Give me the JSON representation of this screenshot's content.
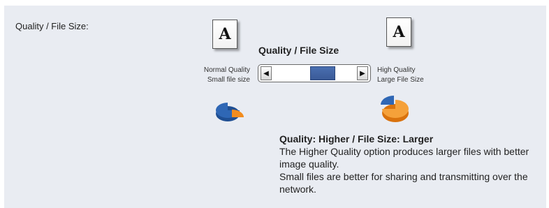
{
  "field_label": "Quality / File Size:",
  "slider": {
    "title": "Quality / File Size",
    "left_label_line1": "Normal Quality",
    "left_label_line2": "Small file size",
    "right_label_line1": "High Quality",
    "right_label_line2": "Large File Size",
    "value_fraction": 0.65,
    "left_arrow_icon": "arrow-left-icon",
    "right_arrow_icon": "arrow-right-icon"
  },
  "icons": {
    "left_doc": "A",
    "right_doc": "A",
    "left_pie": "pie-small-blue-icon",
    "right_pie": "pie-large-orange-icon"
  },
  "description": {
    "title": "Quality: Higher / File Size: Larger",
    "line1": "The Higher Quality option produces larger files with better image quality.",
    "line2": "Small files are better for sharing and transmitting over the network."
  },
  "colors": {
    "panel_bg": "#e9ecf2",
    "thumb": "#4a6fb0",
    "pie_blue": "#2f67b5",
    "pie_orange": "#f28c1e"
  }
}
